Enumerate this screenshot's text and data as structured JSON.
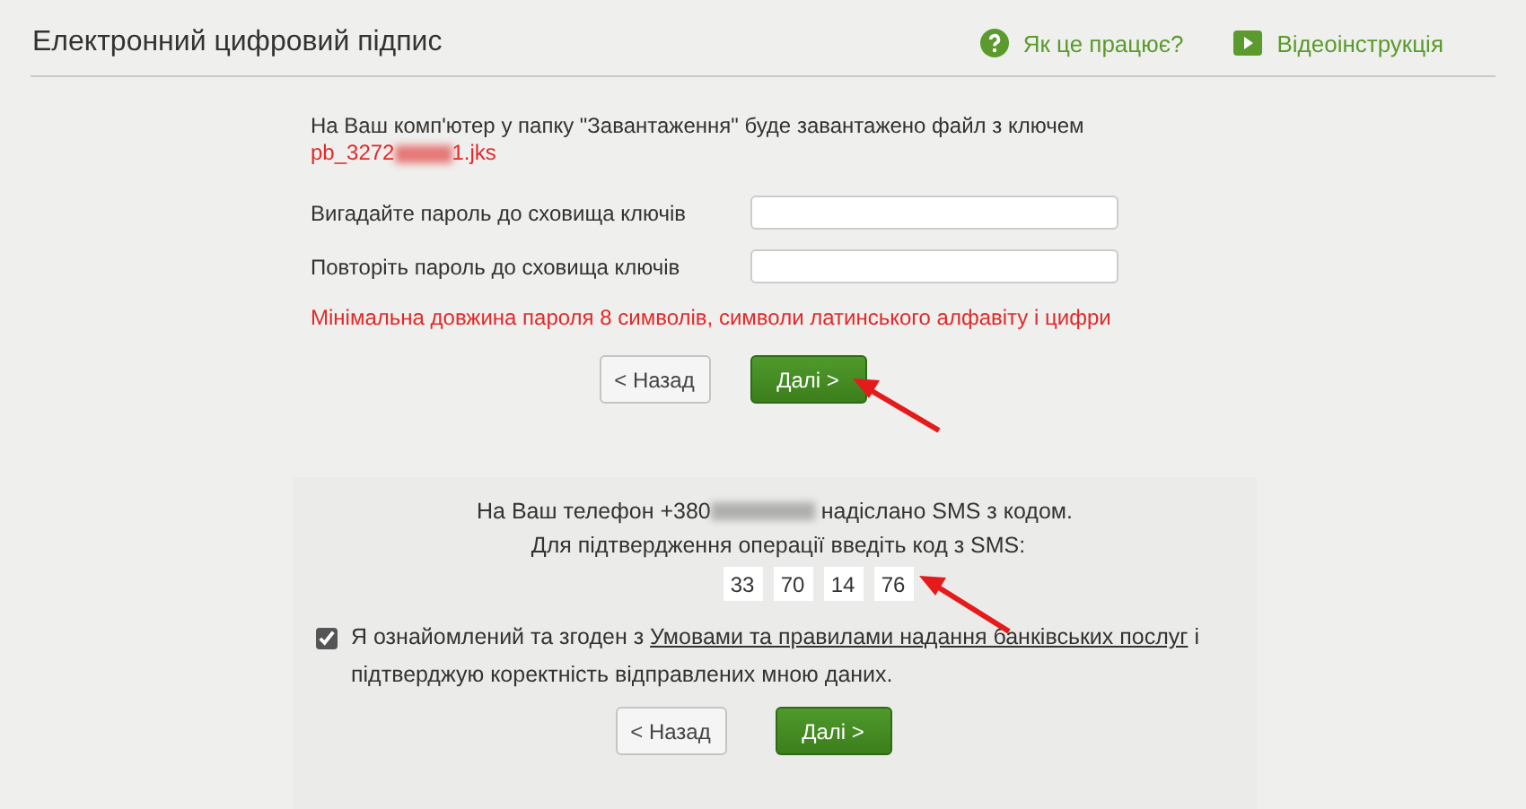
{
  "header": {
    "title": "Електронний цифровий підпис",
    "links": [
      {
        "kind": "help",
        "label": "Як це працює?"
      },
      {
        "kind": "video",
        "label": "Відеоінструкція"
      }
    ]
  },
  "key_step": {
    "notice": "На Ваш комп'ютер у папку \"Завантаження\" буде завантажено файл з ключем",
    "file_name_start": "pb_3272",
    "file_name_end": "1.jks",
    "fields": [
      {
        "label": "Вигадайте пароль до сховища ключів"
      },
      {
        "label": "Повторіть пароль до сховища ключів"
      }
    ],
    "hint": "Мінімальна довжина пароля 8 символів, символи латинського алфавіту і цифри",
    "buttons": [
      {
        "kind": "back",
        "label": "< Назад"
      },
      {
        "kind": "next",
        "label": "Далі >"
      }
    ]
  },
  "sms_step": {
    "phone_start": "На Ваш телефон +380",
    "phone_end": "надіслано SMS з кодом.",
    "prompt": "Для підтвердження операції введіть код з SMS:",
    "code": [
      "33",
      "70",
      "14",
      "76"
    ],
    "agreement": {
      "checked": true,
      "text_start": "Я ознайомлений та згоден з ",
      "link": "Умовами та правилами надання банківських послуг",
      "text_end": " і підтверджую коректність відправлених мною даних."
    },
    "buttons": [
      {
        "kind": "back",
        "label": "< Назад"
      },
      {
        "kind": "next",
        "label": "Далі >"
      }
    ]
  }
}
